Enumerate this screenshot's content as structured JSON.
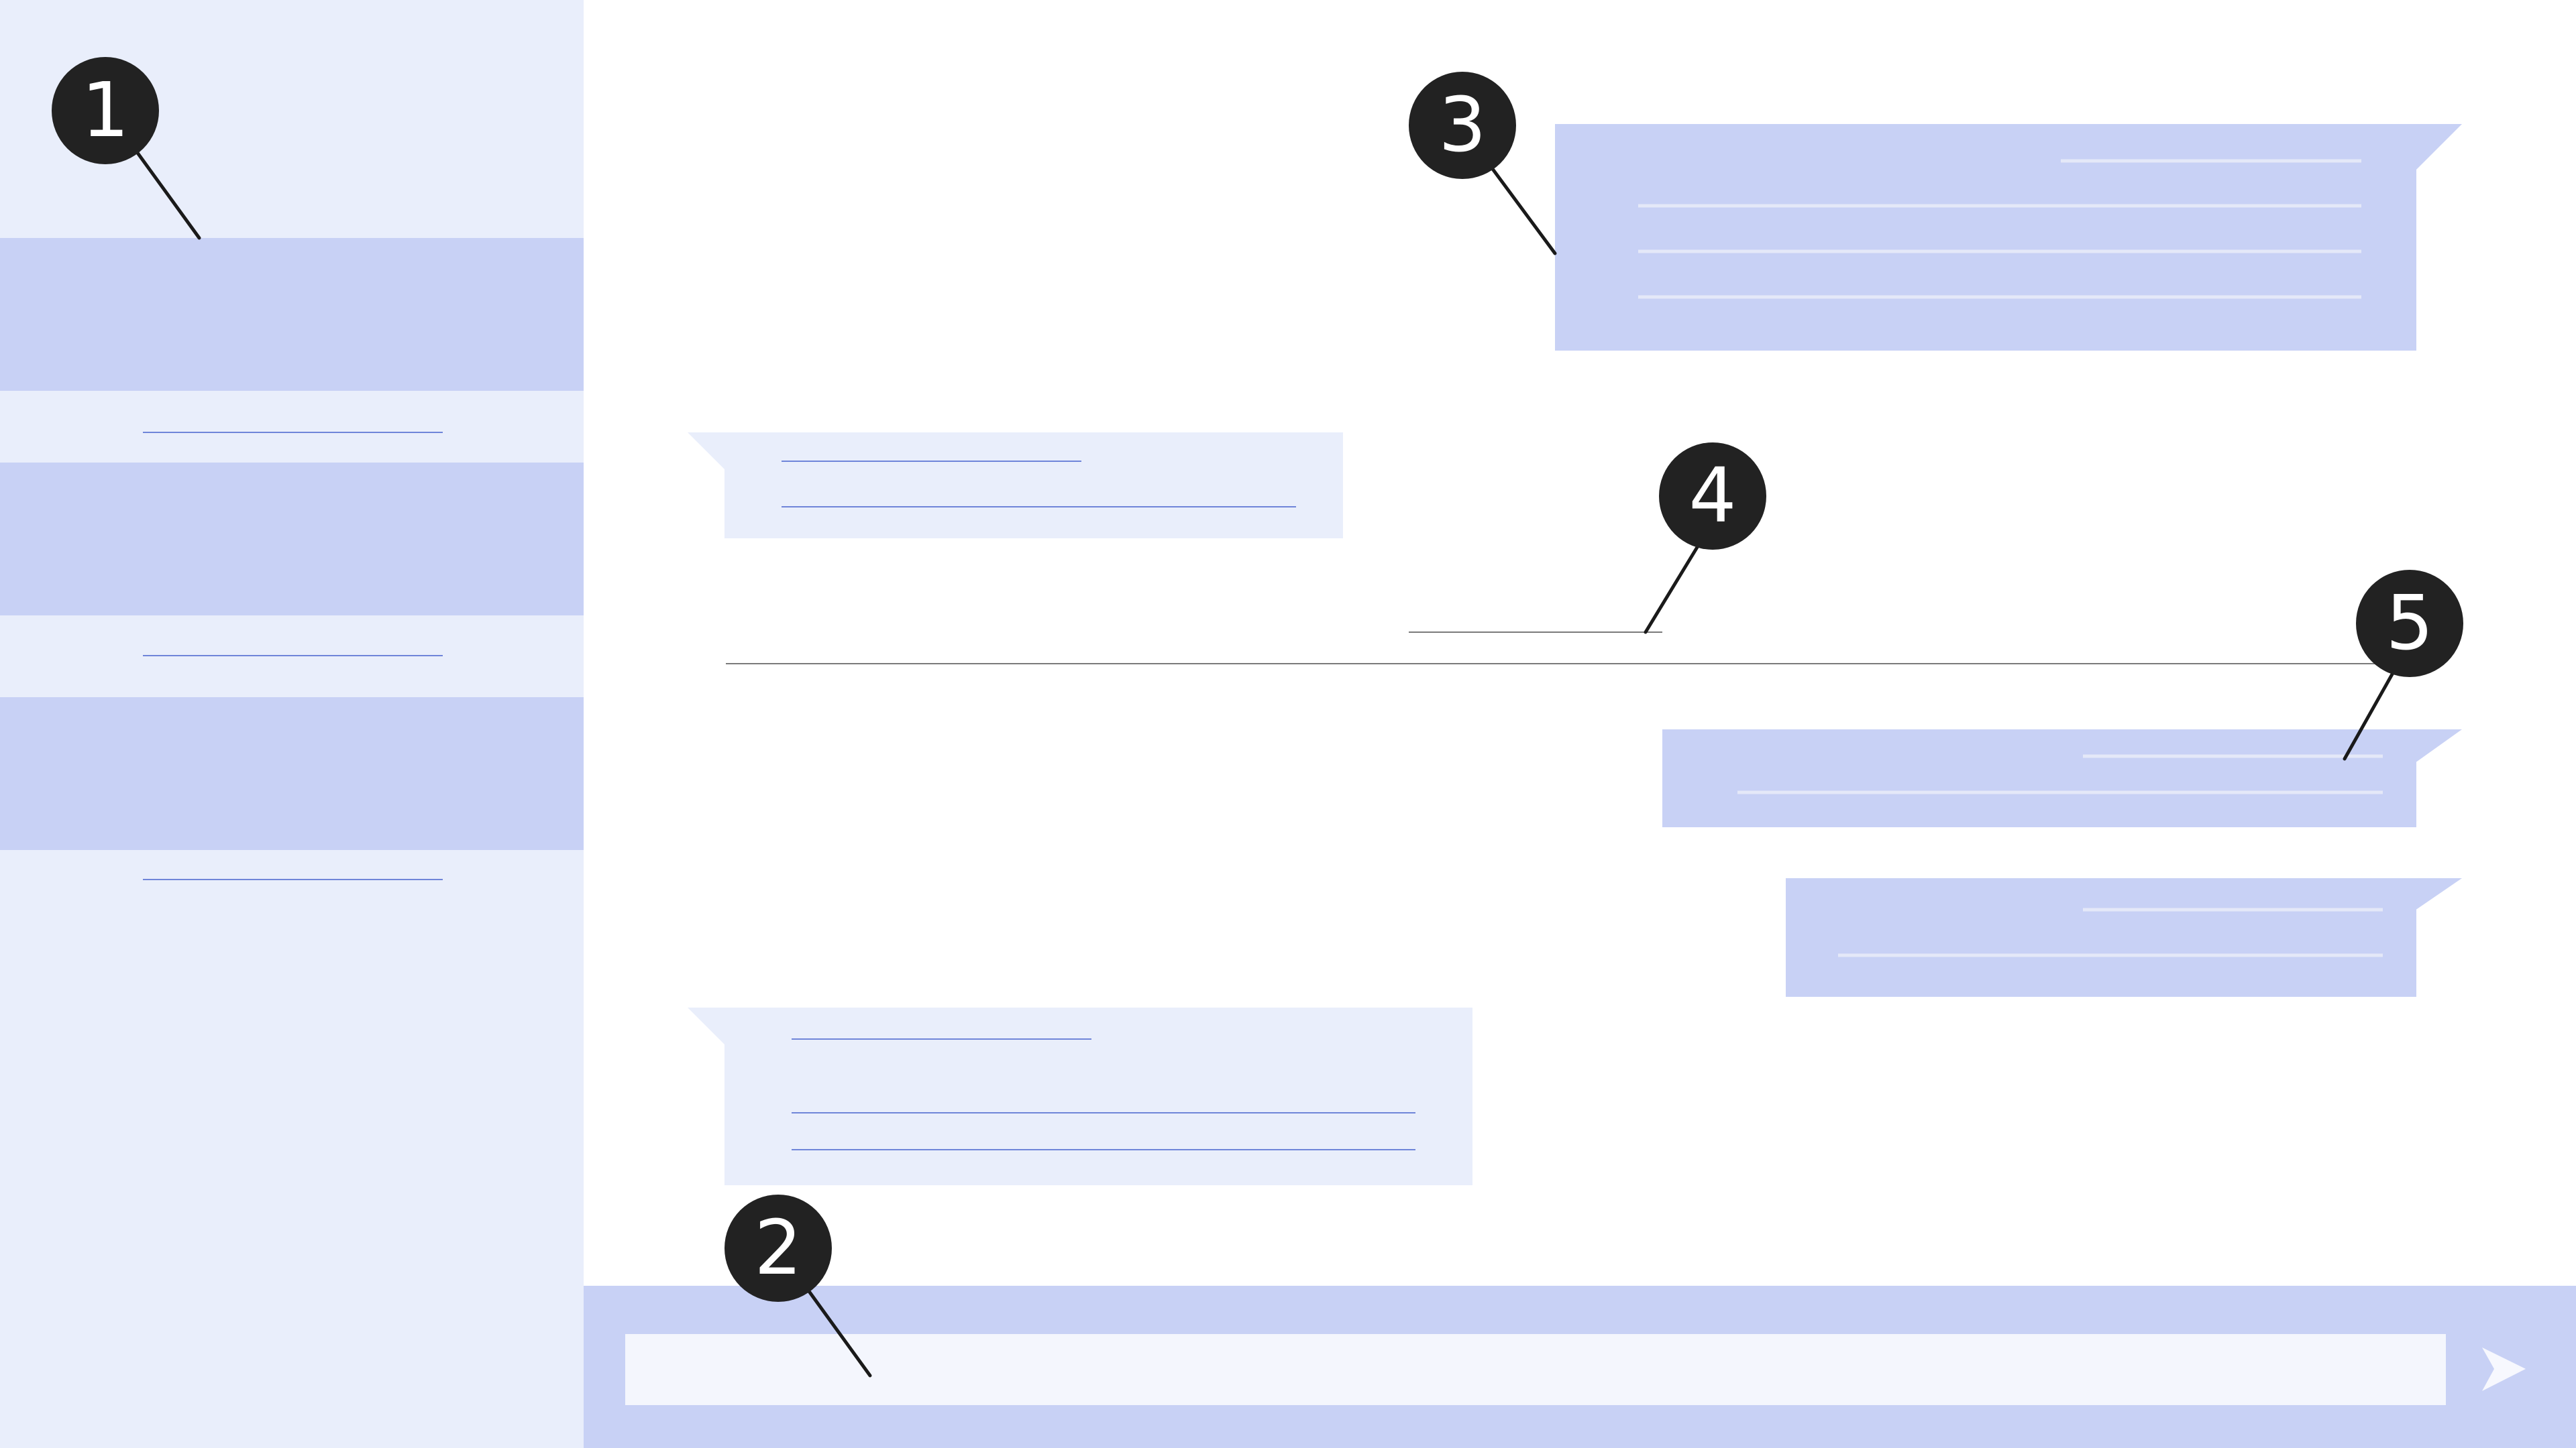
{
  "colors": {
    "sidebar_bg": "#e9eefb",
    "accent": "#c8d1f5",
    "incoming_bubble": "#e9eefb",
    "outgoing_bubble": "#c8d1f5",
    "input_field": "#f4f6fd",
    "placeholder_line_dark": "#6f85d9",
    "placeholder_line_light": "#e4e8f8",
    "divider": "#7a7a7a",
    "marker_fill": "#222222",
    "marker_text": "#ffffff"
  },
  "icons": {
    "send": "send-arrow-icon"
  },
  "callouts": [
    {
      "number": "1",
      "target": "sidebar-conversation-list"
    },
    {
      "number": "2",
      "target": "message-input"
    },
    {
      "number": "3",
      "target": "outgoing-message"
    },
    {
      "number": "4",
      "target": "timestamp-divider"
    },
    {
      "number": "5",
      "target": "message-status"
    }
  ]
}
